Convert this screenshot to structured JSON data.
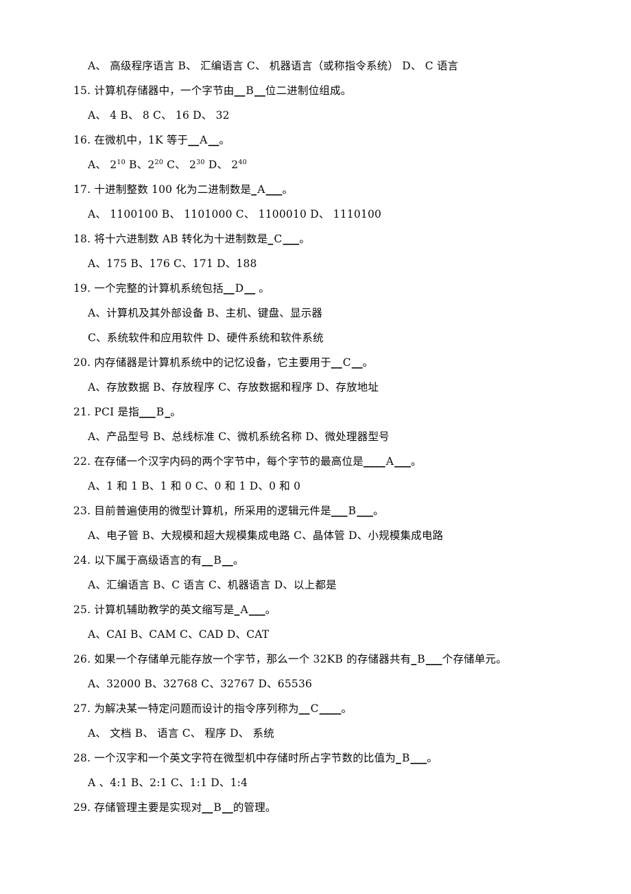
{
  "document": {
    "type": "multiple-choice-exam",
    "language": "zh-CN",
    "visible_question_range": "15-29",
    "lines": [
      {
        "id": "q14-options",
        "kind": "options",
        "text": "A、 高级程序语言   B、 汇编语言  C、 机器语言（或称指令系统）    D、 C 语言"
      },
      {
        "id": "q15-stem",
        "kind": "stem",
        "number": "15.",
        "before": " 计算机存储器中，一个字节由",
        "blank_left": "__",
        "answer": "B",
        "blank_right": "__",
        "after": "位二进制位组成。"
      },
      {
        "id": "q15-options",
        "kind": "options",
        "text": "A、 4  B、 8  C、 16  D、 32"
      },
      {
        "id": "q16-stem",
        "kind": "stem",
        "number": "16.",
        "before": " 在微机中，1K 等于",
        "blank_left": "__",
        "answer": "A",
        "blank_right": "__",
        "after": "。"
      },
      {
        "id": "q16-options",
        "kind": "options-sup",
        "parts": [
          {
            "t": "A、  2",
            "sup": "10"
          },
          {
            "t": "   B、2",
            "sup": "20"
          },
          {
            "t": "  C、  2",
            "sup": "30"
          },
          {
            "t": "   D、  2",
            "sup": "40"
          }
        ]
      },
      {
        "id": "q17-stem",
        "kind": "stem",
        "number": "17.",
        "before": "  十进制整数 100 化为二进制数是",
        "blank_left": "_",
        "answer": "A",
        "blank_right": "___",
        "after": "。"
      },
      {
        "id": "q17-options",
        "kind": "options",
        "text": "A、  1100100   B、  1101000   C、  1100010   D、  1110100"
      },
      {
        "id": "q18-stem",
        "kind": "stem",
        "number": "18.",
        "before": "  将十六进制数 AB 转化为十进制数是",
        "blank_left": "_",
        "answer": "C",
        "blank_right": "___",
        "after": "。"
      },
      {
        "id": "q18-options",
        "kind": "options",
        "text": "A、175 B、176 C、171  D、188"
      },
      {
        "id": "q19-stem",
        "kind": "stem",
        "number": "19.",
        "before": "  一个完整的计算机系统包括",
        "blank_left": "__",
        "answer": "D",
        "blank_right": "__",
        "after": " 。"
      },
      {
        "id": "q19-options-ab",
        "kind": "options",
        "text": "A、计算机及其外部设备 B、主机、键盘、显示器"
      },
      {
        "id": "q19-options-cd",
        "kind": "options",
        "text": "C、系统软件和应用软件 D、硬件系统和软件系统"
      },
      {
        "id": "q20-stem",
        "kind": "stem",
        "number": "20.",
        "before": "  内存储器是计算机系统中的记忆设备，它主要用于",
        "blank_left": "__",
        "answer": "C",
        "blank_right": "__",
        "after": "。"
      },
      {
        "id": "q20-options",
        "kind": "options",
        "text": "A、存放数据 B、存放程序 C、存放数据和程序 D、存放地址"
      },
      {
        "id": "q21-stem",
        "kind": "stem",
        "number": "21.",
        "before": "  PCI 是指",
        "blank_left": "___",
        "answer": "B",
        "blank_right": "_",
        "after": "。"
      },
      {
        "id": "q21-options",
        "kind": "options",
        "text": "A、产品型号 B、总线标准 C、微机系统名称 D、微处理器型号"
      },
      {
        "id": "q22-stem",
        "kind": "stem",
        "number": "22.",
        "before": "  在存储一个汉字内码的两个字节中，每个字节的最高位是",
        "blank_left": "____",
        "answer": "A",
        "blank_right": "___",
        "after": "。"
      },
      {
        "id": "q22-options",
        "kind": "options",
        "text": "A、1 和 1 B、1 和 0 C、0 和 1 D、0 和 0"
      },
      {
        "id": "q23-stem",
        "kind": "stem",
        "number": "23.",
        "before": "  目前普遍使用的微型计算机，所采用的逻辑元件是",
        "blank_left": "___",
        "answer": "B",
        "blank_right": "___",
        "after": "。"
      },
      {
        "id": "q23-options",
        "kind": "options",
        "text": "A、电子管 B、大规模和超大规模集成电路 C、晶体管 D、小规模集成电路"
      },
      {
        "id": "q24-stem",
        "kind": "stem",
        "number": "24.",
        "before": "  以下属于高级语言的有",
        "blank_left": "__",
        "answer": "B",
        "blank_right": "__",
        "after": "。"
      },
      {
        "id": "q24-options",
        "kind": "options",
        "text": "A、汇编语言 B、C 语言 C、机器语言 D、以上都是"
      },
      {
        "id": "q25-stem",
        "kind": "stem",
        "number": "25.",
        "before": "  计算机辅助教学的英文缩写是",
        "blank_left": "_",
        "answer": "A",
        "blank_right": "___",
        "after": "。"
      },
      {
        "id": "q25-options",
        "kind": "options",
        "text": "A、CAI B、CAM  C、CAD  D、CAT"
      },
      {
        "id": "q26-stem",
        "kind": "stem",
        "number": "26.",
        "before": "  如果一个存储单元能存放一个字节，那么一个 32KB 的存储器共有",
        "blank_left": "_",
        "answer": "B",
        "blank_right": "___",
        "after": "个存储单元。"
      },
      {
        "id": "q26-options",
        "kind": "options",
        "text": "A、32000  B、32768  C、32767  D、65536"
      },
      {
        "id": "q27-stem",
        "kind": "stem",
        "number": "27.",
        "before": "  为解决某一特定问题而设计的指令序列称为",
        "blank_left": "__",
        "answer": "C",
        "blank_right": "____",
        "after": "。"
      },
      {
        "id": "q27-options",
        "kind": "options",
        "text": "A、  文档  B、  语言  C、  程序 D、  系统"
      },
      {
        "id": "q28-stem",
        "kind": "stem",
        "number": "28.",
        "before": "  一个汉字和一个英文字符在微型机中存储时所占字节数的比值为",
        "blank_left": "_",
        "answer": "B",
        "blank_right": "___",
        "after": "。"
      },
      {
        "id": "q28-options",
        "kind": "options",
        "text": "A 、4:1   B、2:1   C、1:1   D、1:4"
      },
      {
        "id": "q29-stem",
        "kind": "stem",
        "number": "29.",
        "before": " 存储管理主要是实现对",
        "blank_left": "__",
        "answer": "B",
        "blank_right": "__",
        "after": "的管理。"
      }
    ]
  }
}
